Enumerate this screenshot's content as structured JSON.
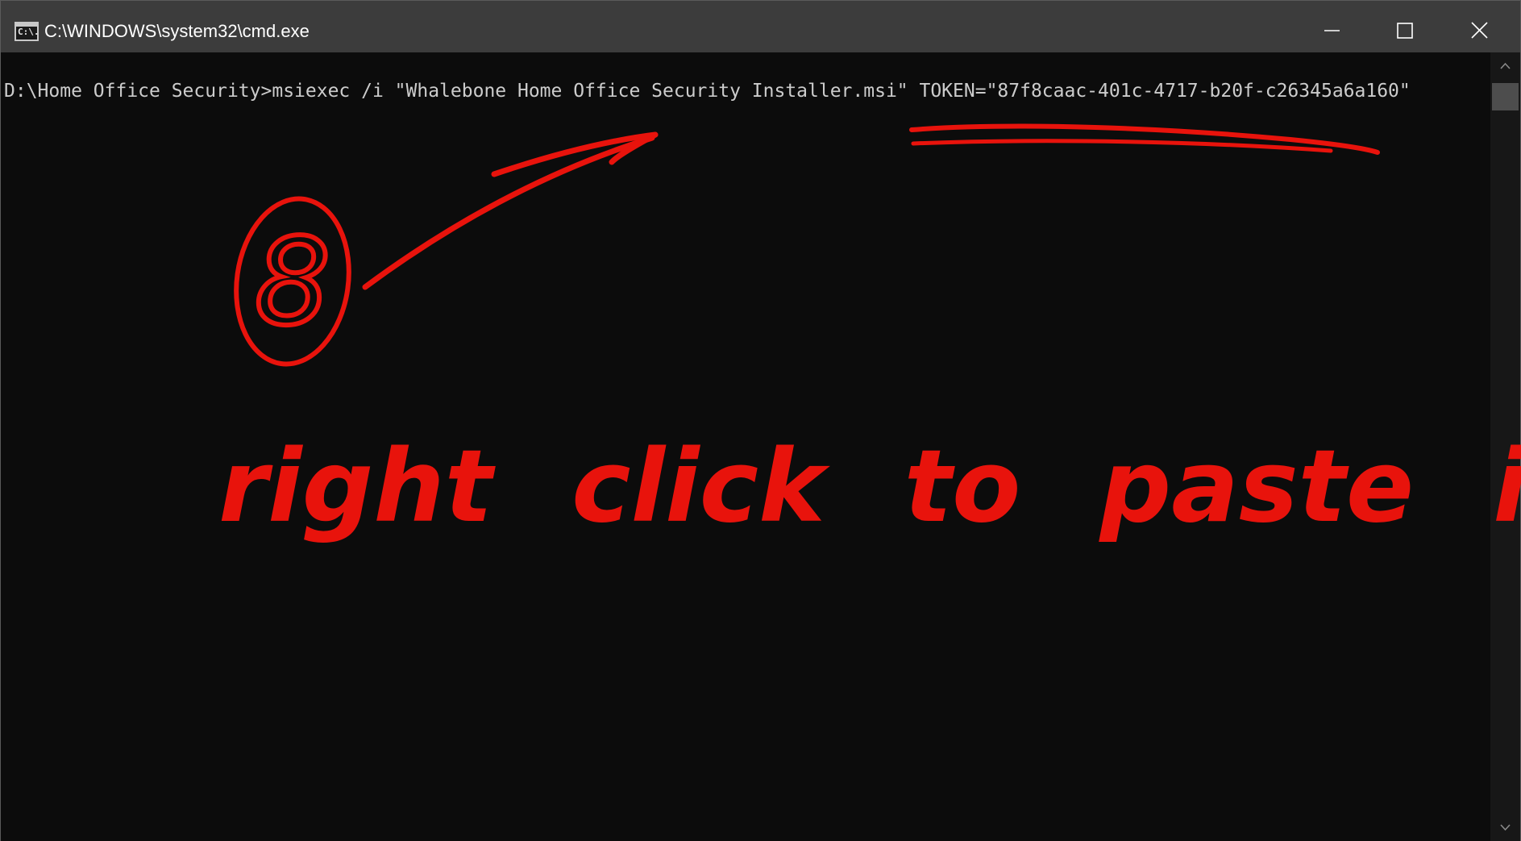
{
  "window": {
    "title": "C:\\WINDOWS\\system32\\cmd.exe",
    "icon": "cmd-console-icon",
    "icon_glyph": "C:\\.",
    "controls": {
      "minimize": "minimize-icon",
      "maximize": "maximize-icon",
      "close": "close-icon"
    }
  },
  "console": {
    "prompt": "D:\\Home Office Security>",
    "command": "msiexec /i \"Whalebone Home Office Security Installer.msi\" TOKEN=",
    "token_value": "\"87f8caac-401c-4717-b20f-c26345a6a160\"",
    "background_color": "#0c0c0c",
    "text_color": "#cccccc"
  },
  "annotation": {
    "step_number": "8",
    "instruction": "right click to paste it",
    "color": "#e8130c"
  }
}
